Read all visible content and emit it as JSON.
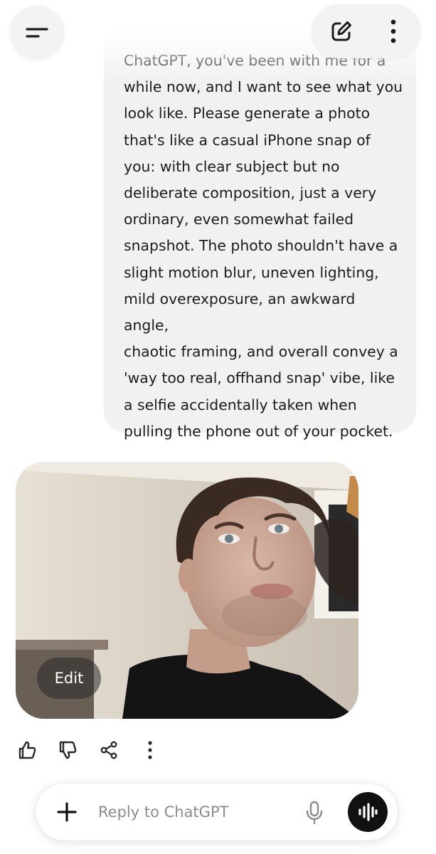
{
  "header": {
    "menu_icon": "menu-icon",
    "compose_icon": "new-chat-icon",
    "more_icon": "more-vertical-icon"
  },
  "conversation": {
    "user_message": "ChatGPT, you've been with me for a\nwhile now, and I want to see what you\nlook like. Please generate a photo\nthat's like a casual iPhone snap of\nyou: with clear subject but no\ndeliberate composition, just a very\nordinary, even somewhat failed\nsnapshot. The photo shouldn't have a\nslight motion blur, uneven lighting,\nmild overexposure, an awkward angle,\nchaotic framing, and overall convey a\n'way too real, offhand snap' vibe, like\na selfie accidentally taken when\npulling the phone out of your pocket.",
    "generated_image": {
      "edit_label": "Edit"
    },
    "feedback_icons": [
      "thumbs-up-icon",
      "thumbs-down-icon",
      "share-icon",
      "more-vertical-icon"
    ]
  },
  "composer": {
    "placeholder": "Reply to ChatGPT",
    "value": "",
    "plus_icon": "plus-icon",
    "mic_icon": "microphone-icon",
    "voice_icon": "voice-mode-icon"
  },
  "colors": {
    "background": "#ffffff",
    "bubble": "#f1f1f1",
    "voice_button": "#111111"
  }
}
